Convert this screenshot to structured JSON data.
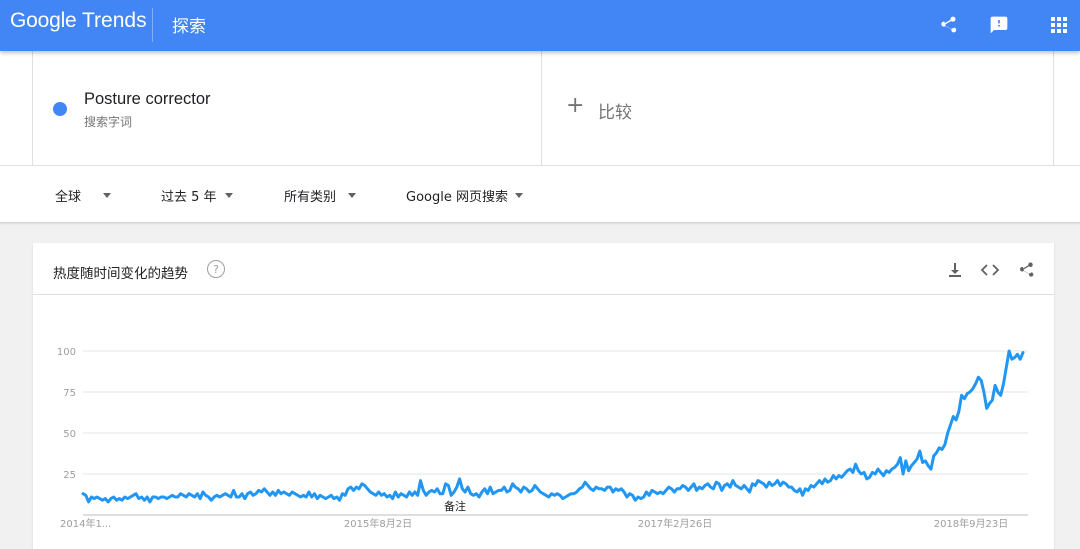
{
  "header": {
    "logo_google": "Google",
    "logo_trends": "Trends",
    "explore_label": "探索",
    "icons": [
      "share-icon",
      "feedback-icon",
      "apps-grid-icon"
    ],
    "bar_color": "#4285f4"
  },
  "search": {
    "term": "Posture corrector",
    "term_type": "搜索字词",
    "term_color": "#4285f4",
    "compare_label": "比较"
  },
  "filters": {
    "region": "全球",
    "time": "过去 5 年",
    "category": "所有类别",
    "property": "Google 网页搜索"
  },
  "card": {
    "title": "热度随时间变化的趋势",
    "icons": [
      "help-icon",
      "download-icon",
      "embed-code-icon",
      "share-icon"
    ]
  },
  "chart_data": {
    "type": "line",
    "title": "",
    "xlabel": "",
    "ylabel": "",
    "y_ticks": [
      "100",
      "75",
      "50",
      "25"
    ],
    "ylim": [
      0,
      100
    ],
    "x_tick_labels": [
      "2014年1...",
      "2015年8月2日",
      "2017年2月26日",
      "2018年9月23日"
    ],
    "note_label": "备注",
    "grid": true,
    "series": [
      {
        "color": "#2196f3",
        "values": [
          13,
          12,
          8,
          11,
          10,
          11,
          10,
          9,
          10,
          8,
          10,
          11,
          9,
          10,
          9,
          11,
          10,
          11,
          12,
          13,
          10,
          11,
          9,
          11,
          8,
          11,
          11,
          10,
          11,
          11,
          10,
          11,
          12,
          11,
          11,
          13,
          12,
          11,
          13,
          12,
          11,
          13,
          10,
          14,
          12,
          11,
          9,
          11,
          12,
          11,
          12,
          13,
          12,
          11,
          15,
          11,
          11,
          13,
          10,
          13,
          14,
          12,
          13,
          15,
          14,
          16,
          14,
          12,
          14,
          12,
          15,
          13,
          14,
          13,
          12,
          14,
          13,
          12,
          11,
          12,
          11,
          14,
          11,
          13,
          10,
          12,
          11,
          10,
          11,
          12,
          10,
          11,
          9,
          13,
          12,
          16,
          17,
          15,
          17,
          16,
          19,
          18,
          16,
          14,
          13,
          12,
          14,
          12,
          13,
          11,
          12,
          10,
          14,
          11,
          13,
          12,
          11,
          14,
          12,
          14,
          12,
          21,
          15,
          12,
          14,
          15,
          14,
          16,
          13,
          13,
          19,
          18,
          12,
          14,
          17,
          22,
          16,
          14,
          17,
          13,
          12,
          13,
          11,
          14,
          16,
          13,
          17,
          13,
          14,
          15,
          15,
          17,
          14,
          15,
          19,
          17,
          16,
          14,
          17,
          16,
          14,
          15,
          18,
          16,
          14,
          13,
          12,
          11,
          13,
          12,
          13,
          12,
          10,
          11,
          12,
          13,
          13,
          14,
          16,
          17,
          20,
          18,
          16,
          15,
          17,
          16,
          16,
          15,
          17,
          17,
          14,
          16,
          15,
          16,
          14,
          11,
          13,
          12,
          9,
          11,
          10,
          11,
          14,
          12,
          15,
          14,
          13,
          14,
          13,
          15,
          17,
          16,
          14,
          16,
          16,
          18,
          17,
          15,
          17,
          19,
          15,
          17,
          16,
          18,
          19,
          17,
          16,
          20,
          19,
          15,
          18,
          19,
          17,
          21,
          18,
          17,
          16,
          18,
          16,
          14,
          19,
          18,
          21,
          20,
          19,
          17,
          20,
          18,
          19,
          21,
          18,
          20,
          19,
          17,
          17,
          15,
          14,
          16,
          12,
          16,
          15,
          18,
          17,
          19,
          21,
          19,
          22,
          20,
          21,
          24,
          22,
          24,
          23,
          25,
          27,
          28,
          26,
          31,
          27,
          25,
          26,
          22,
          23,
          26,
          25,
          28,
          26,
          24,
          27,
          26,
          28,
          29,
          31,
          35,
          25,
          33,
          27,
          30,
          32,
          34,
          39,
          32,
          33,
          30,
          28,
          36,
          38,
          41,
          40,
          43,
          50,
          55,
          60,
          58,
          63,
          73,
          71,
          74,
          75,
          77,
          80,
          84,
          82,
          75,
          65,
          68,
          70,
          79,
          75,
          73,
          80,
          90,
          100,
          95,
          96,
          98,
          95,
          99
        ]
      }
    ]
  }
}
